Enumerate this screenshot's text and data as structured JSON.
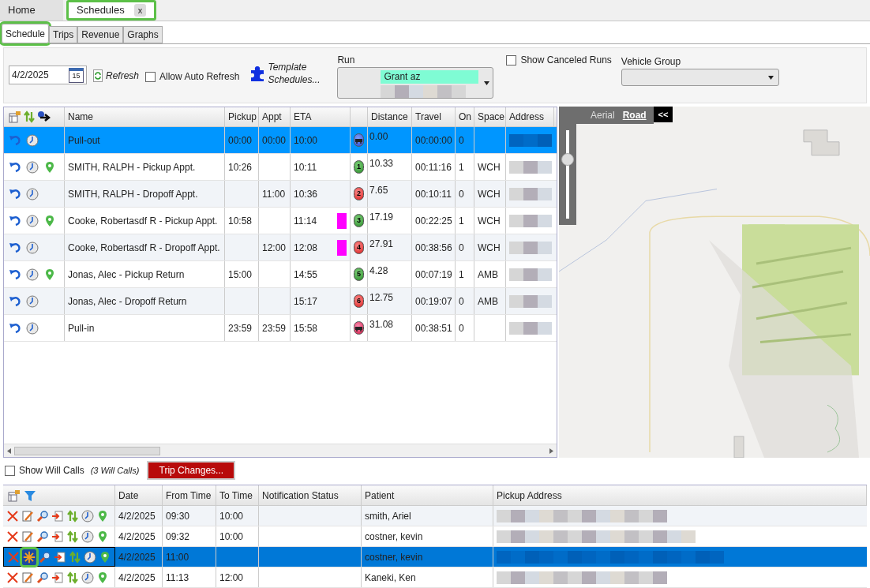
{
  "main_tabs": [
    {
      "label": "Home",
      "selected": false,
      "highlighted": false
    },
    {
      "label": "Schedules",
      "selected": true,
      "close_label": "x",
      "highlighted": true
    }
  ],
  "sub_tabs": [
    {
      "label": "Schedule",
      "selected": true,
      "highlighted": true
    },
    {
      "label": "Trips",
      "selected": false,
      "highlighted": false
    },
    {
      "label": "Revenue",
      "selected": false,
      "highlighted": false
    },
    {
      "label": "Graphs",
      "selected": false,
      "highlighted": false
    }
  ],
  "toolbar": {
    "date": "4/2/2025",
    "calendar_day": "15",
    "refresh": "Refresh",
    "auto_refresh": {
      "label": "Allow Auto Refresh",
      "checked": false
    },
    "template": "Template Schedules...",
    "run_label": "Run",
    "run_value": "Grant az",
    "show_canceled": {
      "label": "Show Canceled Runs",
      "checked": false
    },
    "vehicle_group_label": "Vehicle Group"
  },
  "schedule_table": {
    "columns": [
      "Name",
      "Pickup",
      "Appt",
      "ETA",
      "Distance",
      "Travel",
      "On",
      "Space",
      "Address"
    ],
    "rows": [
      {
        "name": "Pull-out",
        "pickup": "00:00",
        "appt": "00:00",
        "eta": "10:00",
        "flag": false,
        "kind": "vehicle",
        "distance": "0.00",
        "travel": "00:00:00",
        "on": "0",
        "space": "",
        "pin": false,
        "selected": true
      },
      {
        "name": "SMITH, RALPH - Pickup Appt.",
        "pickup": "10:26",
        "appt": "",
        "eta": "10:11",
        "flag": false,
        "kind": "pickup",
        "stop_number": "1",
        "distance": "10.33",
        "travel": "00:11:16",
        "on": "1",
        "space": "WCH",
        "pin": true,
        "selected": false
      },
      {
        "name": "SMITH, RALPH - Dropoff Appt.",
        "pickup": "",
        "appt": "11:00",
        "eta": "10:36",
        "flag": false,
        "kind": "dropoff",
        "stop_number": "2",
        "distance": "7.65",
        "travel": "00:10:11",
        "on": "0",
        "space": "WCH",
        "pin": false,
        "selected": false
      },
      {
        "name": "Cooke, Robertasdf R - Pickup Appt.",
        "pickup": "10:58",
        "appt": "",
        "eta": "11:14",
        "flag": true,
        "kind": "pickup",
        "stop_number": "3",
        "distance": "17.19",
        "travel": "00:22:25",
        "on": "1",
        "space": "WCH",
        "pin": true,
        "selected": false
      },
      {
        "name": "Cooke, Robertasdf R - Dropoff Appt.",
        "pickup": "",
        "appt": "12:00",
        "eta": "12:08",
        "flag": true,
        "kind": "dropoff",
        "stop_number": "4",
        "distance": "27.91",
        "travel": "00:38:56",
        "on": "0",
        "space": "WCH",
        "pin": false,
        "selected": false
      },
      {
        "name": "Jonas, Alec - Pickup Return",
        "pickup": "15:00",
        "appt": "",
        "eta": "14:55",
        "flag": false,
        "kind": "pickup",
        "stop_number": "5",
        "distance": "4.28",
        "travel": "00:07:19",
        "on": "1",
        "space": "AMB",
        "pin": true,
        "selected": false
      },
      {
        "name": "Jonas, Alec - Dropoff Return",
        "pickup": "",
        "appt": "",
        "eta": "15:17",
        "flag": false,
        "kind": "dropoff",
        "stop_number": "6",
        "distance": "12.75",
        "travel": "00:19:07",
        "on": "0",
        "space": "AMB",
        "pin": false,
        "selected": false
      },
      {
        "name": "Pull-in",
        "pickup": "23:59",
        "appt": "23:59",
        "eta": "15:58",
        "flag": false,
        "kind": "vehicle_end",
        "distance": "31.08",
        "travel": "00:38:51",
        "on": "0",
        "space": "",
        "pin": false,
        "selected": false
      }
    ]
  },
  "map": {
    "modes": [
      {
        "label": "Aerial",
        "selected": false
      },
      {
        "label": "Road",
        "selected": true
      }
    ],
    "collapse": "<<",
    "zoom": {
      "level": 0.7
    }
  },
  "will_calls": {
    "show": {
      "label": "Show Will Calls",
      "checked": false
    },
    "count": "(3 Will Calls)",
    "trip_changes": "Trip Changes..."
  },
  "trips_table": {
    "columns": [
      "Date",
      "From Time",
      "To Time",
      "Notification Status",
      "Patient",
      "Pickup Address"
    ],
    "rows": [
      {
        "date": "4/2/2025",
        "from": "09:30",
        "to": "10:00",
        "notification": "",
        "patient": "smith, Ariel",
        "selected": false,
        "busy": false
      },
      {
        "date": "4/2/2025",
        "from": "09:32",
        "to": "10:00",
        "notification": "",
        "patient": "costner, kevin",
        "selected": false,
        "busy": false
      },
      {
        "date": "4/2/2025",
        "from": "11:00",
        "to": "",
        "notification": "",
        "patient": "costner, kevin",
        "selected": true,
        "busy": true
      },
      {
        "date": "4/2/2025",
        "from": "11:13",
        "to": "12:00",
        "notification": "",
        "patient": "Kaneki, Ken",
        "selected": false,
        "busy": false
      }
    ]
  }
}
